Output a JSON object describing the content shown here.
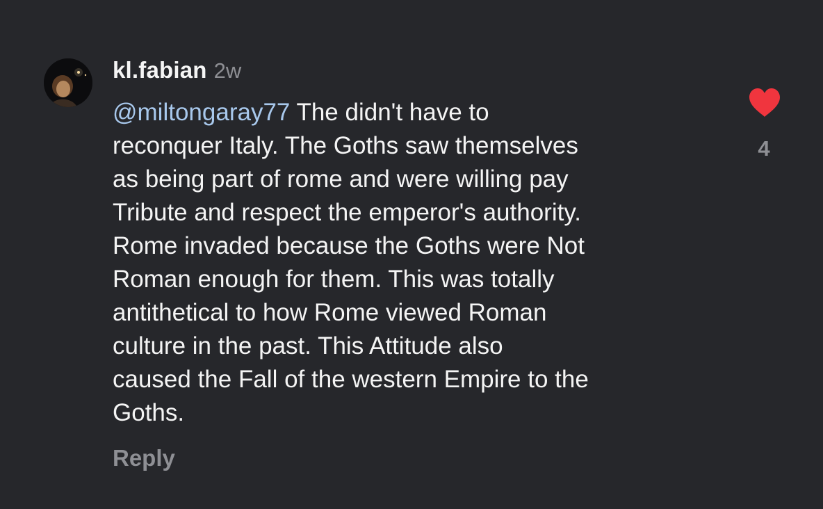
{
  "comment": {
    "username": "kl.fabian",
    "timestamp": "2w",
    "mention": "@miltongaray77",
    "lines": [
      " The didn't have to",
      "reconquer Italy. The Goths saw themselves",
      "as being part of rome and were willing pay",
      "Tribute and respect the emperor's authority.",
      "Rome invaded because the Goths were Not",
      "Roman enough for them. This was totally",
      "antithetical to how Rome viewed Roman",
      "culture in the past. This Attitude also",
      "caused the Fall of the western Empire to the",
      "Goths."
    ],
    "reply_label": "Reply",
    "like_count": "4",
    "like_icon": "heart-icon",
    "liked": true
  },
  "colors": {
    "background": "#26272b",
    "mention": "#a8c8ec",
    "heart": "#f0353e",
    "muted": "#8e8f94"
  }
}
